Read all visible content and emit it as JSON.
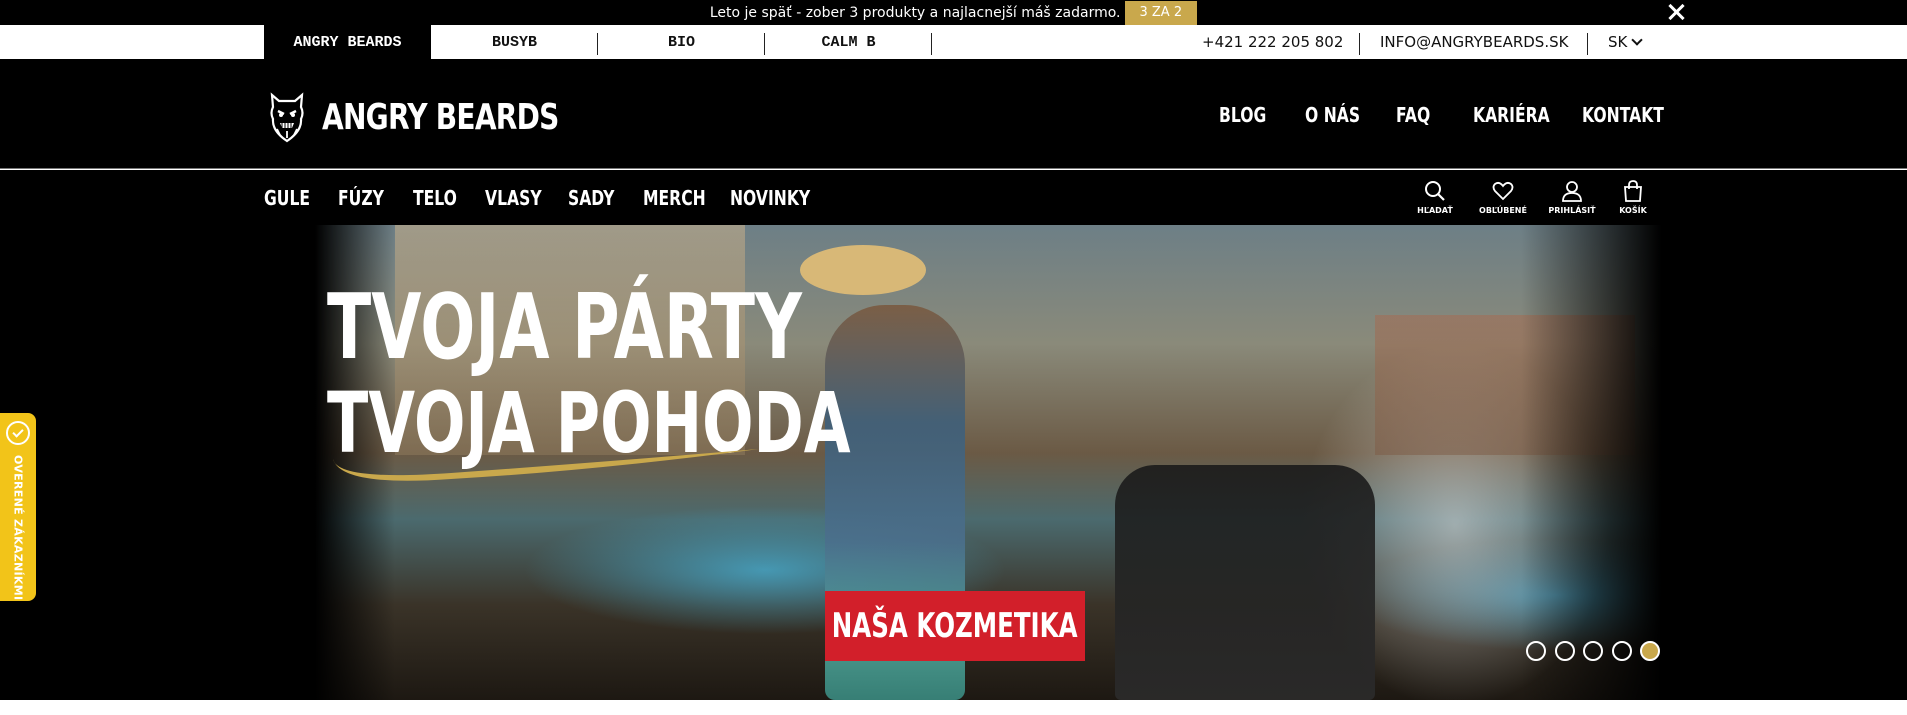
{
  "announcement": {
    "text": "Leto je späť - zober 3 produkty a najlacnejší máš zadarmo.",
    "badge": "3 ZA 2"
  },
  "brand_bar": {
    "tabs": [
      {
        "label": "ANGRY BEARDS",
        "active": true
      },
      {
        "label": "BUSYB",
        "active": false
      },
      {
        "label": "BIO",
        "active": false
      },
      {
        "label": "CALM B",
        "active": false
      }
    ],
    "phone": "+421 222 205 802",
    "email": "INFO@ANGRYBEARDS.SK",
    "language": "SK"
  },
  "header": {
    "logo_text": "ANGRY BEARDS",
    "nav": [
      "BLOG",
      "O NÁS",
      "FAQ",
      "KARIÉRA",
      "KONTAKT"
    ]
  },
  "categories": [
    "GULE",
    "FÚZY",
    "TELO",
    "VLASY",
    "SADY",
    "MERCH",
    "NOVINKY"
  ],
  "utility": [
    {
      "label": "HĽADAŤ",
      "icon": "search-icon"
    },
    {
      "label": "OBĽÚBENÉ",
      "icon": "heart-icon"
    },
    {
      "label": "PRIHLÁSIŤ",
      "icon": "user-icon"
    },
    {
      "label": "KOŠÍK",
      "icon": "bag-icon"
    }
  ],
  "hero": {
    "line1": "TVOJA PÁRTY",
    "line2": "TVOJA POHODA",
    "cta": "NAŠA KOZMETIKA",
    "slide_count": 5,
    "active_slide": 5
  },
  "verified_badge": "OVERENÉ ZÁKAZNÍKMI",
  "colors": {
    "accent_gold": "#c9a84c",
    "cta_red": "#d21f2a",
    "badge_yellow": "#f2c419",
    "header_bg": "#000000"
  }
}
